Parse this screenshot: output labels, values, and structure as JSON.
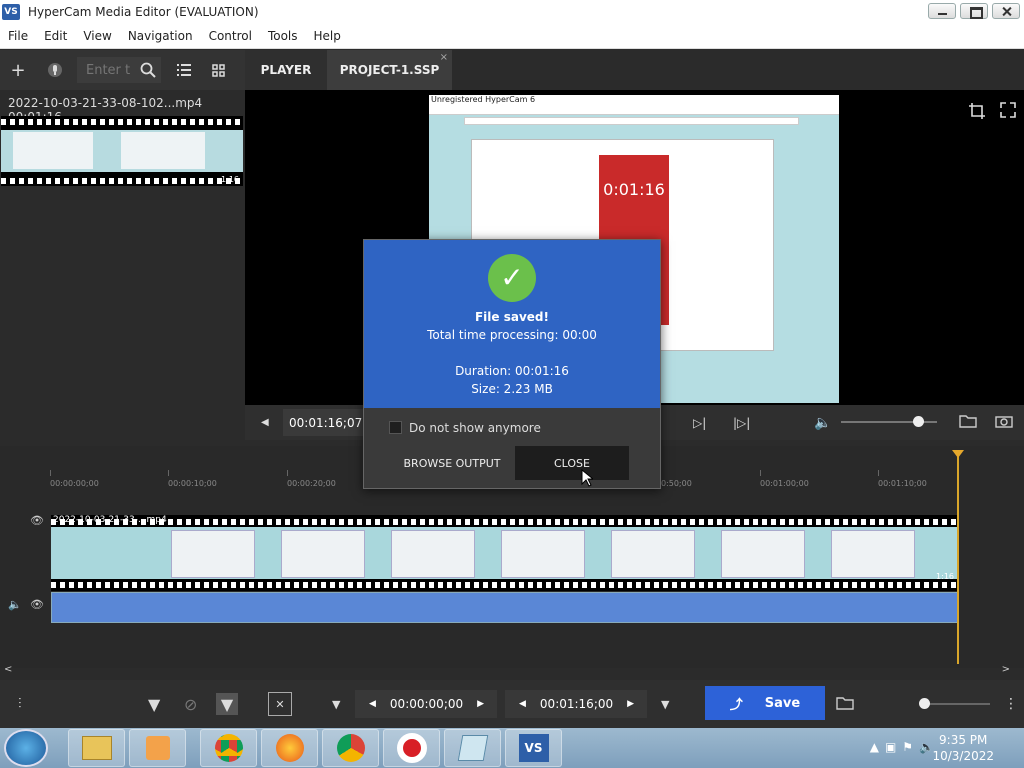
{
  "window": {
    "title": "HyperCam Media Editor  (EVALUATION)",
    "icon_text": "VS"
  },
  "menu": [
    "File",
    "Edit",
    "View",
    "Navigation",
    "Control",
    "Tools",
    "Help"
  ],
  "toolbar": {
    "search_placeholder": "Enter t",
    "icons": [
      "plus-icon",
      "microphone-icon",
      "search-icon",
      "list-view-icon",
      "grid-view-icon"
    ]
  },
  "tabs": [
    {
      "label": "PLAYER"
    },
    {
      "label": "PROJECT-1.SSP"
    }
  ],
  "media": {
    "item_label": "2022-10-03-21-33-08-102...mp4 00:01:16",
    "thumb_duration": "1:16"
  },
  "preview": {
    "window_caption": "Unregistered HyperCam 6",
    "timer": "0:01:16"
  },
  "player": {
    "timecode": "00:01:16;07"
  },
  "dialog": {
    "title": "File saved!",
    "processing": "Total time processing: 00:00",
    "duration": "Duration: 00:01:16",
    "size": "Size: 2.23 MB",
    "checkbox_label": "Do not show anymore",
    "browse_label": "BROWSE OUTPUT",
    "close_label": "CLOSE"
  },
  "timeline": {
    "ticks": [
      "00:00:00;00",
      "00:00:10;00",
      "00:00:20;00",
      "00:00:50;00",
      "00:01:00;00",
      "00:01:10;00"
    ],
    "clip_name": "2022-10-03-21-33-...mp4",
    "clip_duration": "1:16"
  },
  "bottom": {
    "start_time": "00:00:00;00",
    "end_time": "00:01:16;00",
    "save_label": "Save"
  },
  "taskbar": {
    "time": "9:35 PM",
    "date": "10/3/2022"
  },
  "colors": {
    "accent": "#2d62d8",
    "dialog_blue": "#2f64c3",
    "playhead": "#d9a62a",
    "success": "#6bc04b"
  }
}
